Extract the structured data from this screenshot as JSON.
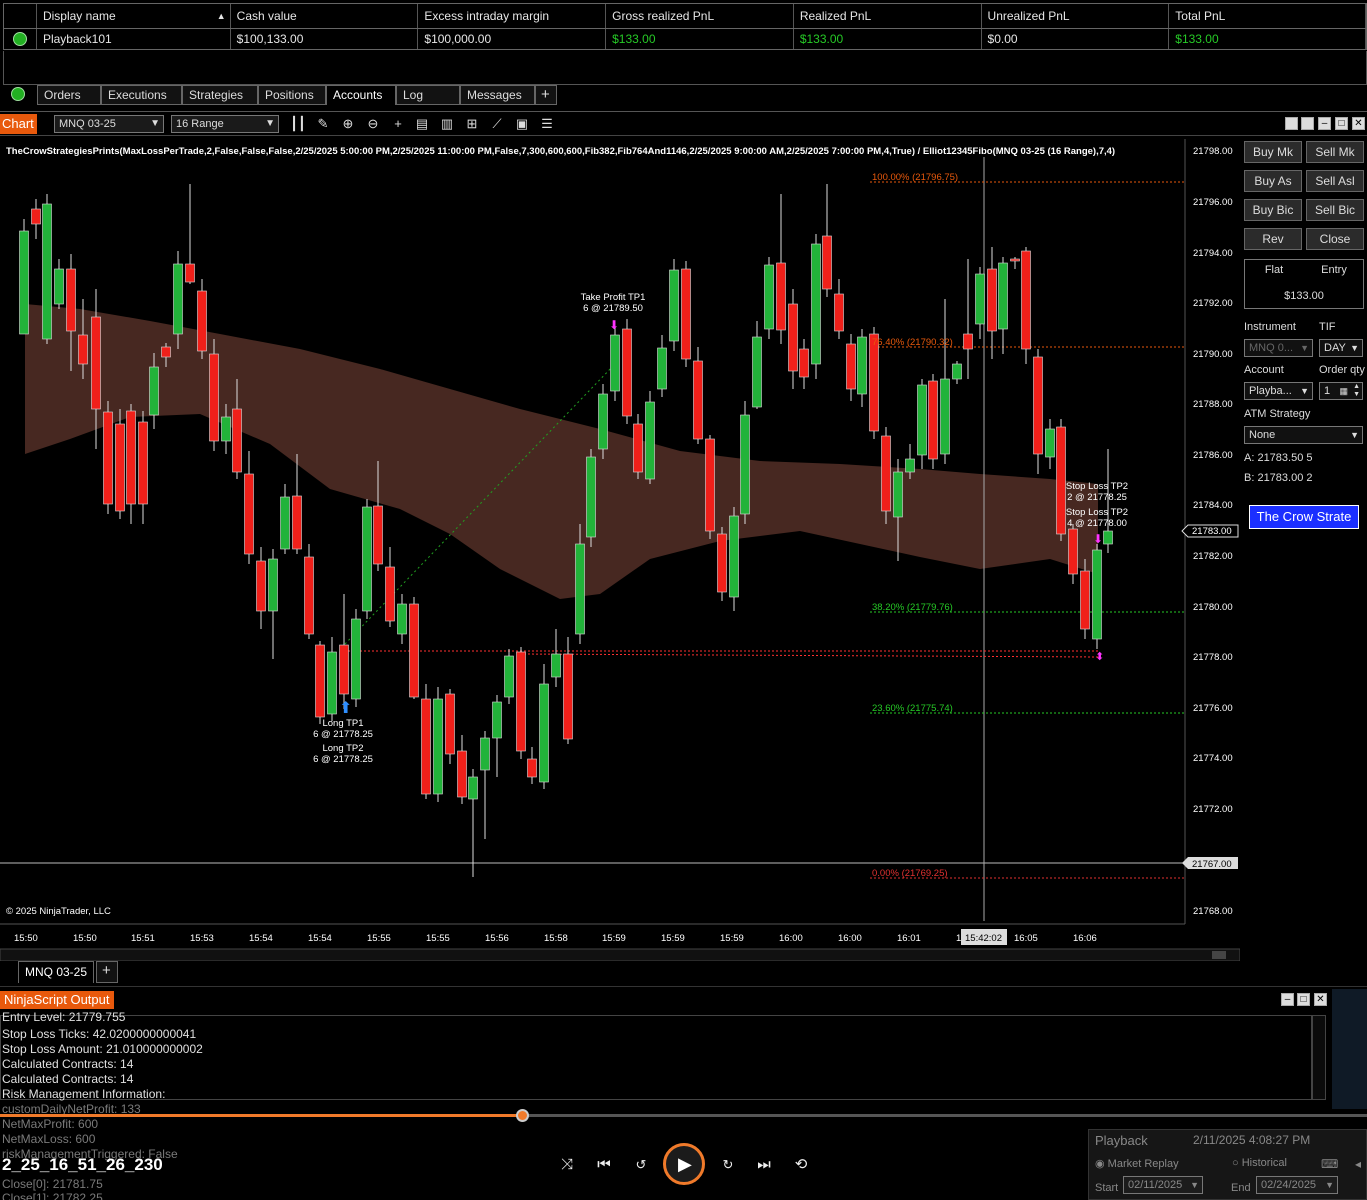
{
  "accounts": {
    "headers": [
      "Display name",
      "Cash value",
      "Excess intraday margin",
      "Gross realized PnL",
      "Realized PnL",
      "Unrealized PnL",
      "Total PnL"
    ],
    "row": {
      "display_name": "Playback101",
      "cash_value": "$100,133.00",
      "excess_margin": "$100,000.00",
      "gross_realized": "$133.00",
      "realized": "$133.00",
      "unrealized": "$0.00",
      "total": "$133.00"
    },
    "positive_color": "#26c926"
  },
  "tabs": [
    "Orders",
    "Executions",
    "Strategies",
    "Positions",
    "Accounts",
    "Log",
    "Messages",
    "+"
  ],
  "active_tab": "Accounts",
  "toolbar": {
    "chart_label": "Chart",
    "instrument": "MNQ 03-25",
    "interval": "16 Range"
  },
  "chart": {
    "header": "TheCrowStrategiesPrints(MaxLossPerTrade,2,False,False,False,2/25/2025 5:00:00 PM,2/25/2025 11:00:00 PM,False,7,300,600,600,Fib382,Fib764And1146,2/25/2025 9:00:00 AM,2/25/2025 7:00:00 PM,4,True) / Elliot12345Fibo(MNQ 03-25 (16 Range),7,4)",
    "copyright": "© 2025 NinjaTrader, LLC",
    "price_labels": [
      "21798.00",
      "21796.00",
      "21794.00",
      "21792.00",
      "21790.00",
      "21788.00",
      "21786.00",
      "21784.00",
      "21782.00",
      "21780.00",
      "21778.00",
      "21776.00",
      "21774.00",
      "21772.00",
      "21768.00"
    ],
    "current_price": "21783.00",
    "crosshair_price": "21767.00",
    "crosshair_time": "15:42:02",
    "time_labels": [
      "15:50",
      "15:50",
      "15:51",
      "15:53",
      "15:54",
      "15:54",
      "15:55",
      "15:55",
      "15:56",
      "15:58",
      "15:59",
      "15:59",
      "15:59",
      "16:00",
      "16:00",
      "16:01",
      "1",
      "16:05",
      "16:06"
    ],
    "fib": [
      {
        "label": "100.00% (21796.75)",
        "color": "#e8590c"
      },
      {
        "label": "76.40% (21790.32)",
        "color": "#e8590c"
      },
      {
        "label": "38.20% (21779.76)",
        "color": "#26c926"
      },
      {
        "label": "23.60% (21775.74)",
        "color": "#26c926"
      },
      {
        "label": "0.00% (21769.25)",
        "color": "#e03030"
      }
    ],
    "annotations": {
      "tp1_title": "Take Profit TP1",
      "tp1_val": "6 @ 21789.50",
      "long1_title": "Long TP1",
      "long1_val": "6 @ 21778.25",
      "long2_title": "Long TP2",
      "long2_val": "6 @ 21778.25",
      "sl1_title": "Stop Loss TP2",
      "sl1_val": "2 @ 21778.25",
      "sl2_title": "Stop Loss TP2",
      "sl2_val": "4 @ 21778.00"
    },
    "up_color": "#22b33a",
    "down_color": "#f0201a"
  },
  "panel": {
    "buy_mkt": "Buy Mk",
    "sell_mkt": "Sell Mk",
    "buy_ask": "Buy As",
    "sell_ask": "Sell Asl",
    "buy_bid": "Buy Bic",
    "sell_bid": "Sell Bic",
    "rev": "Rev",
    "close": "Close",
    "flat": "Flat",
    "entry": "Entry",
    "pnl": "$133.00",
    "instrument_label": "Instrument",
    "tif_label": "TIF",
    "instrument": "MNQ 0...",
    "tif": "DAY",
    "account_label": "Account",
    "qty_label": "Order qty",
    "account": "Playba...",
    "qty": "1",
    "atm_label": "ATM Strategy",
    "atm": "None",
    "ask_line": "A:  21783.50   5",
    "bid_line": "B:  21783.00   2",
    "crow_button": "The Crow Strate"
  },
  "strip": {
    "tab": "MNQ 03-25",
    "add": "+"
  },
  "output": {
    "title": "NinjaScript Output",
    "lines": [
      "Entry Level: 21779.755",
      "Stop Loss Ticks: 42.0200000000041",
      "Stop Loss Amount: 21.010000000002",
      "Calculated Contracts: 14",
      "Calculated Contracts: 14",
      "Risk Management Information:"
    ],
    "dim_lines": [
      "customDailyNetProfit: 133",
      "NetMaxProfit: 600",
      "NetMaxLoss: 600",
      "riskManagementTriggered: False",
      "Close[0]: 21781.75",
      "Close[1]: 21782.25"
    ]
  },
  "player": {
    "filename": "2_25_16_51_26_230",
    "progress": 0.382,
    "accent": "#f07a2a"
  },
  "playback": {
    "title": "Playback",
    "datetime": "2/11/2025 4:08:27 PM",
    "market_replay": "Market Replay",
    "historical": "Historical",
    "start_label": "Start",
    "start": "02/11/2025",
    "end_label": "End",
    "end": "02/24/2025"
  }
}
